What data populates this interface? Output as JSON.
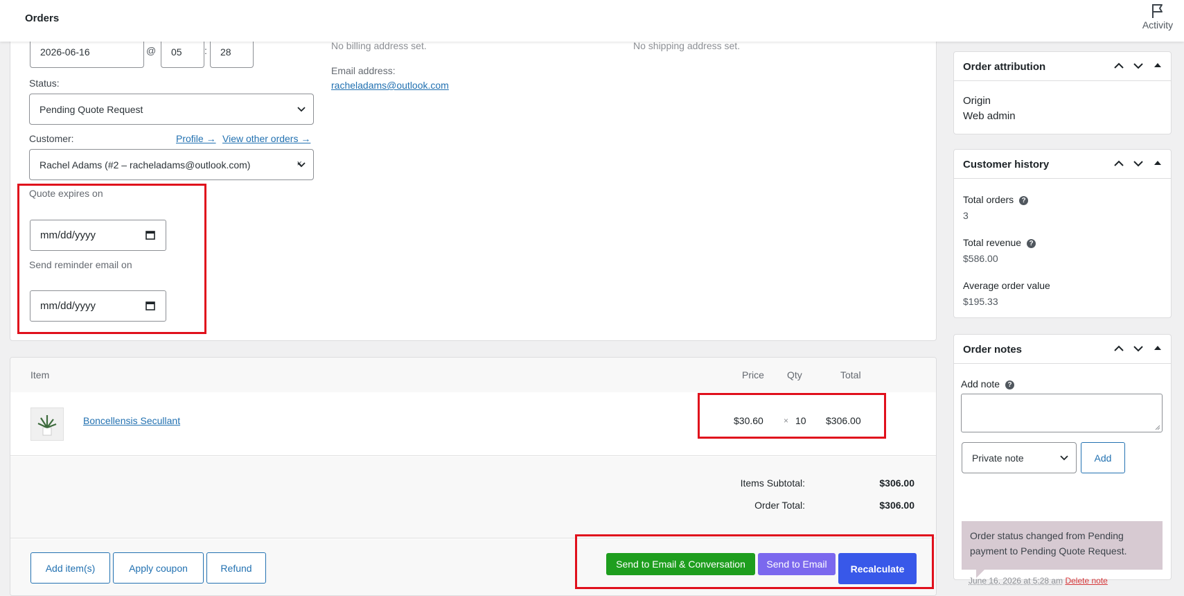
{
  "topbar": {
    "title": "Orders",
    "activity_label": "Activity"
  },
  "order": {
    "date": "2026-06-16",
    "at": "@",
    "hour": "05",
    "colon": ":",
    "minute": "28",
    "status_label": "Status:",
    "status_value": "Pending Quote Request",
    "customer_label": "Customer:",
    "profile_link": "Profile →",
    "other_orders_link": "View other orders →",
    "customer_value": "Rachel Adams (#2 – racheladams@outlook.com)",
    "clear_glyph": "×",
    "quote_expires_label": "Quote expires on",
    "quote_expires_placeholder": "mm/dd/yyyy",
    "reminder_label": "Send reminder email on",
    "reminder_placeholder": "mm/dd/yyyy",
    "billing_text": "No billing address set.",
    "shipping_text": "No shipping address set.",
    "email_label": "Email address:",
    "email_value": "racheladams@outlook.com"
  },
  "items": {
    "headers": {
      "item": "Item",
      "price": "Price",
      "qty": "Qty",
      "total": "Total"
    },
    "rows": [
      {
        "name": "Boncellensis Secullant",
        "price": "$30.60",
        "times": "×",
        "qty": "10",
        "total": "$306.00"
      }
    ],
    "subtotal_label": "Items Subtotal:",
    "subtotal_value": "$306.00",
    "order_total_label": "Order Total:",
    "order_total_value": "$306.00",
    "buttons": {
      "add_items": "Add item(s)",
      "apply_coupon": "Apply coupon",
      "refund": "Refund",
      "send_email_conversation": "Send to Email & Conversation",
      "send_email": "Send to Email",
      "recalculate": "Recalculate"
    }
  },
  "sidebar": {
    "attribution": {
      "title": "Order attribution",
      "origin_label": "Origin",
      "origin_value": "Web admin"
    },
    "history": {
      "title": "Customer history",
      "total_orders_label": "Total orders",
      "total_orders_value": "3",
      "total_revenue_label": "Total revenue",
      "total_revenue_value": "$586.00",
      "aov_label": "Average order value",
      "aov_value": "$195.33"
    },
    "notes": {
      "title": "Order notes",
      "add_note_label": "Add note",
      "note_type": "Private note",
      "add_button": "Add",
      "note_text": "Order status changed from Pending payment to Pending Quote Request.",
      "note_meta": "June 16, 2026 at 5:28 am",
      "delete_note": "Delete note"
    }
  },
  "colors": {
    "highlight": "#e0101c",
    "green_button": "#1e9e1e",
    "purple_button": "#7b68ee",
    "blue_button": "#3858e9",
    "note_bg": "#d7cad2"
  }
}
